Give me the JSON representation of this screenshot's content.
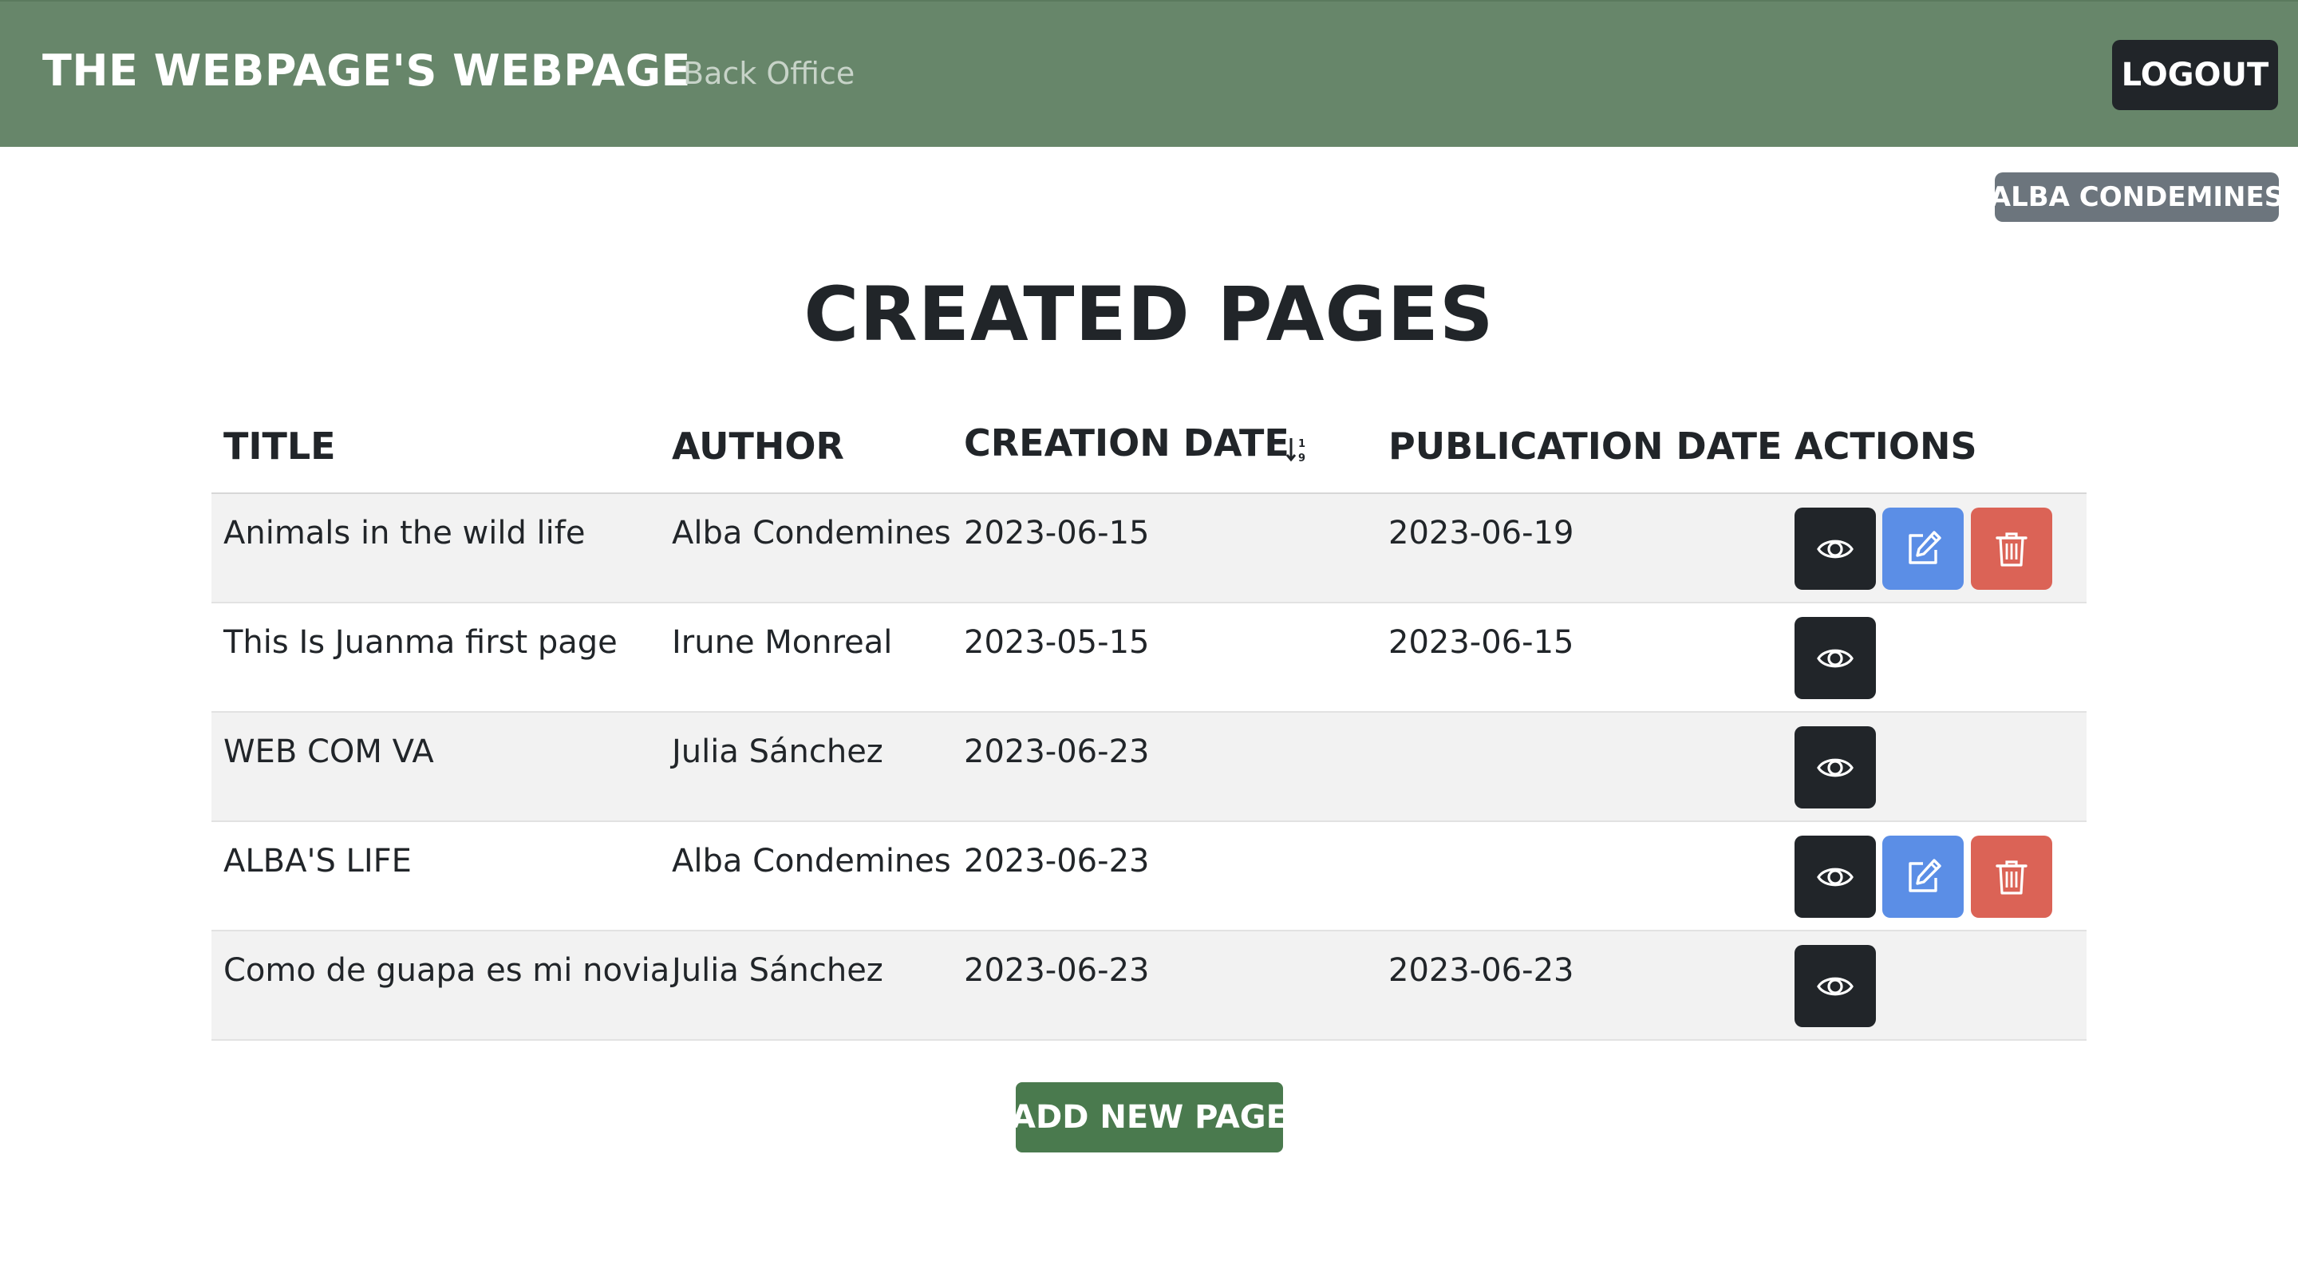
{
  "navbar": {
    "brand": "THE WEBPAGE'S WEBPAGE",
    "link": "Back Office",
    "logout_label": "LOGOUT",
    "background": "#67866a"
  },
  "user": {
    "name": "ALBA CONDEMINES"
  },
  "main": {
    "title": "CREATED PAGES",
    "columns": {
      "title": "TITLE",
      "author": "AUTHOR",
      "creation_date": "CREATION DATE",
      "publication_date": "PUBLICATION DATE",
      "actions": "ACTIONS"
    },
    "sort_indicator": "↓1/9",
    "rows": [
      {
        "title": "Animals in the wild life",
        "author": "Alba Condemines",
        "creation_date": "2023-06-15",
        "publication_date": "2023-06-19",
        "actions": [
          "view-icon",
          "edit-icon",
          "trash-icon"
        ]
      },
      {
        "title": "This Is Juanma first page",
        "author": "Irune Monreal",
        "creation_date": "2023-05-15",
        "publication_date": "2023-06-15",
        "actions": [
          "view-icon"
        ]
      },
      {
        "title": "WEB COM VA",
        "author": "Julia Sánchez",
        "creation_date": "2023-06-23",
        "publication_date": "",
        "actions": [
          "view-icon"
        ]
      },
      {
        "title": "ALBA'S LIFE",
        "author": "Alba Condemines",
        "creation_date": "2023-06-23",
        "publication_date": "",
        "actions": [
          "view-icon",
          "edit-icon",
          "trash-icon"
        ]
      },
      {
        "title": "Como de guapa es mi novia",
        "author": "Julia Sánchez",
        "creation_date": "2023-06-23",
        "publication_date": "2023-06-23",
        "actions": [
          "view-icon"
        ]
      }
    ],
    "add_button_label": "ADD NEW PAGE"
  },
  "colors": {
    "view_button": "#212529",
    "edit_button": "#5b8ee6",
    "delete_button": "#db6356",
    "add_button": "#4a7a4e",
    "badge": "#6c757d"
  }
}
